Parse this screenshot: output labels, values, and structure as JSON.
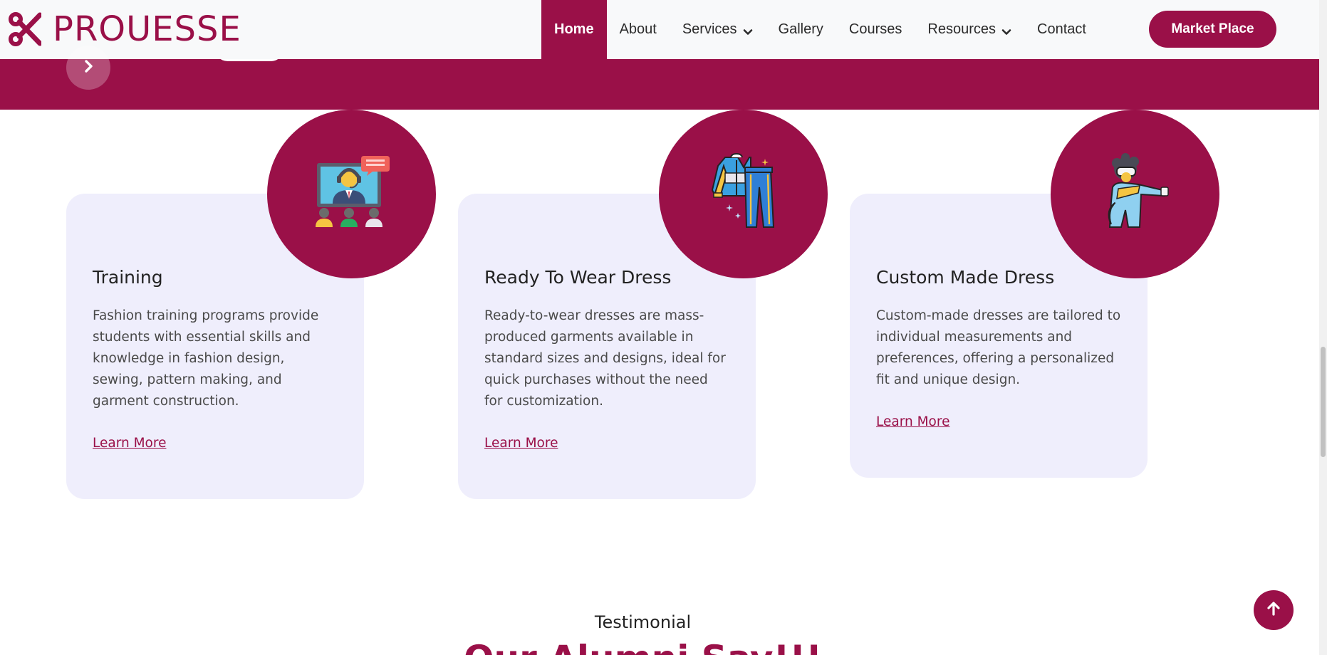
{
  "brand": {
    "name": "PROUESSE",
    "color": "#9a1048"
  },
  "nav": {
    "items": [
      {
        "label": "Home",
        "active": true
      },
      {
        "label": "About"
      },
      {
        "label": "Services",
        "dropdown": true
      },
      {
        "label": "Gallery"
      },
      {
        "label": "Courses"
      },
      {
        "label": "Resources",
        "dropdown": true
      },
      {
        "label": "Contact"
      }
    ],
    "cta": "Market Place"
  },
  "services": [
    {
      "title": "Training",
      "icon": "online-training-icon",
      "description": "Fashion training programs provide students with essential skills and knowledge in fashion design, sewing, pattern making, and garment construction.",
      "link": "Learn More"
    },
    {
      "title": "Ready To Wear Dress",
      "icon": "jacket-pants-icon",
      "description": "Ready-to-wear dresses are mass-produced garments available in standard sizes and designs, ideal for quick purchases without the need for customization.",
      "link": "Learn More"
    },
    {
      "title": "Custom Made Dress",
      "icon": "tailor-measuring-icon",
      "description": "Custom-made dresses are tailored to individual measurements and preferences, offering a personalized fit and unique design.",
      "link": "Learn More"
    }
  ],
  "testimonial": {
    "label": "Testimonial",
    "heading": "Our Alumni Say!!!"
  },
  "icons": {
    "slider": "chevron-right-icon",
    "back_to_top": "arrow-up-icon"
  }
}
